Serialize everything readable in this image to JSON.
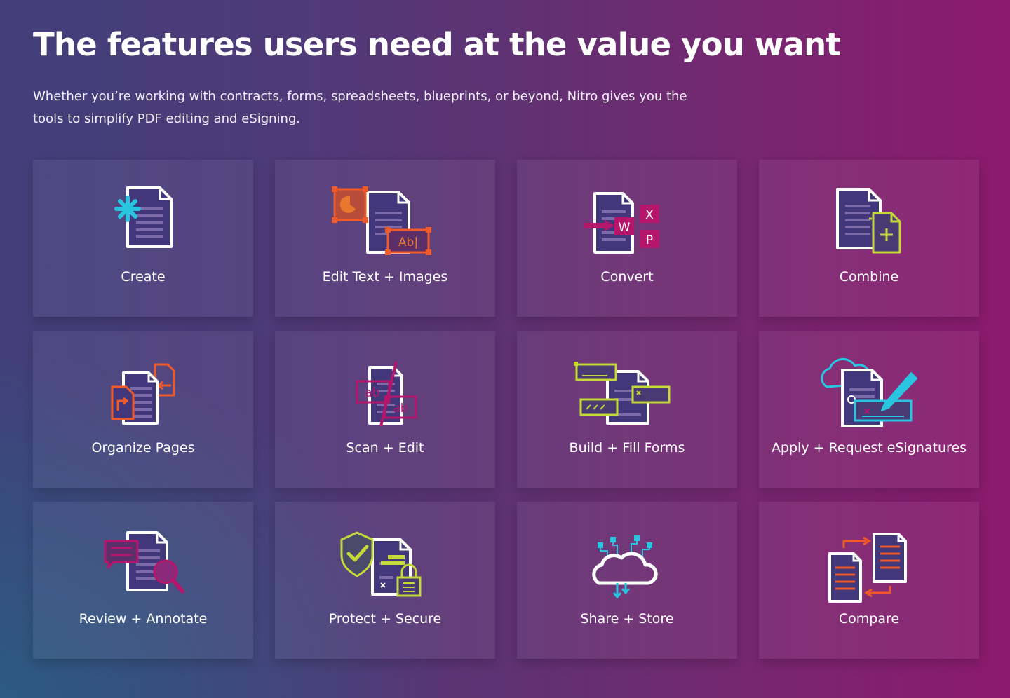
{
  "header": {
    "title": "The features users need at the value you want",
    "description": "Whether you’re working with contracts, forms, spreadsheets, blueprints, or beyond, Nitro gives you the tools to simplify PDF editing and eSigning."
  },
  "colors": {
    "orange": "#f05a28",
    "teal": "#29c5e0",
    "lime": "#c4d838",
    "magenta": "#b5156b",
    "doc_lines": "#7d6aa8",
    "white": "#ffffff"
  },
  "features": [
    {
      "label": "Create",
      "icon": "create-document-icon"
    },
    {
      "label": "Edit Text + Images",
      "icon": "edit-text-images-icon",
      "icon_text": "Ab|"
    },
    {
      "label": "Convert",
      "icon": "convert-office-icon",
      "icon_text": [
        "W",
        "X",
        "P"
      ]
    },
    {
      "label": "Combine",
      "icon": "combine-documents-icon"
    },
    {
      "label": "Organize Pages",
      "icon": "organize-pages-icon"
    },
    {
      "label": "Scan + Edit",
      "icon": "scan-edit-icon",
      "icon_text": [
        "ab",
        "ab"
      ]
    },
    {
      "label": "Build + Fill Forms",
      "icon": "build-fill-forms-icon"
    },
    {
      "label": "Apply + Request eSignatures",
      "icon": "esignature-icon"
    },
    {
      "label": "Review + Annotate",
      "icon": "review-annotate-icon"
    },
    {
      "label": "Protect + Secure",
      "icon": "protect-secure-icon"
    },
    {
      "label": "Share + Store",
      "icon": "share-store-cloud-icon"
    },
    {
      "label": "Compare",
      "icon": "compare-documents-icon"
    }
  ]
}
